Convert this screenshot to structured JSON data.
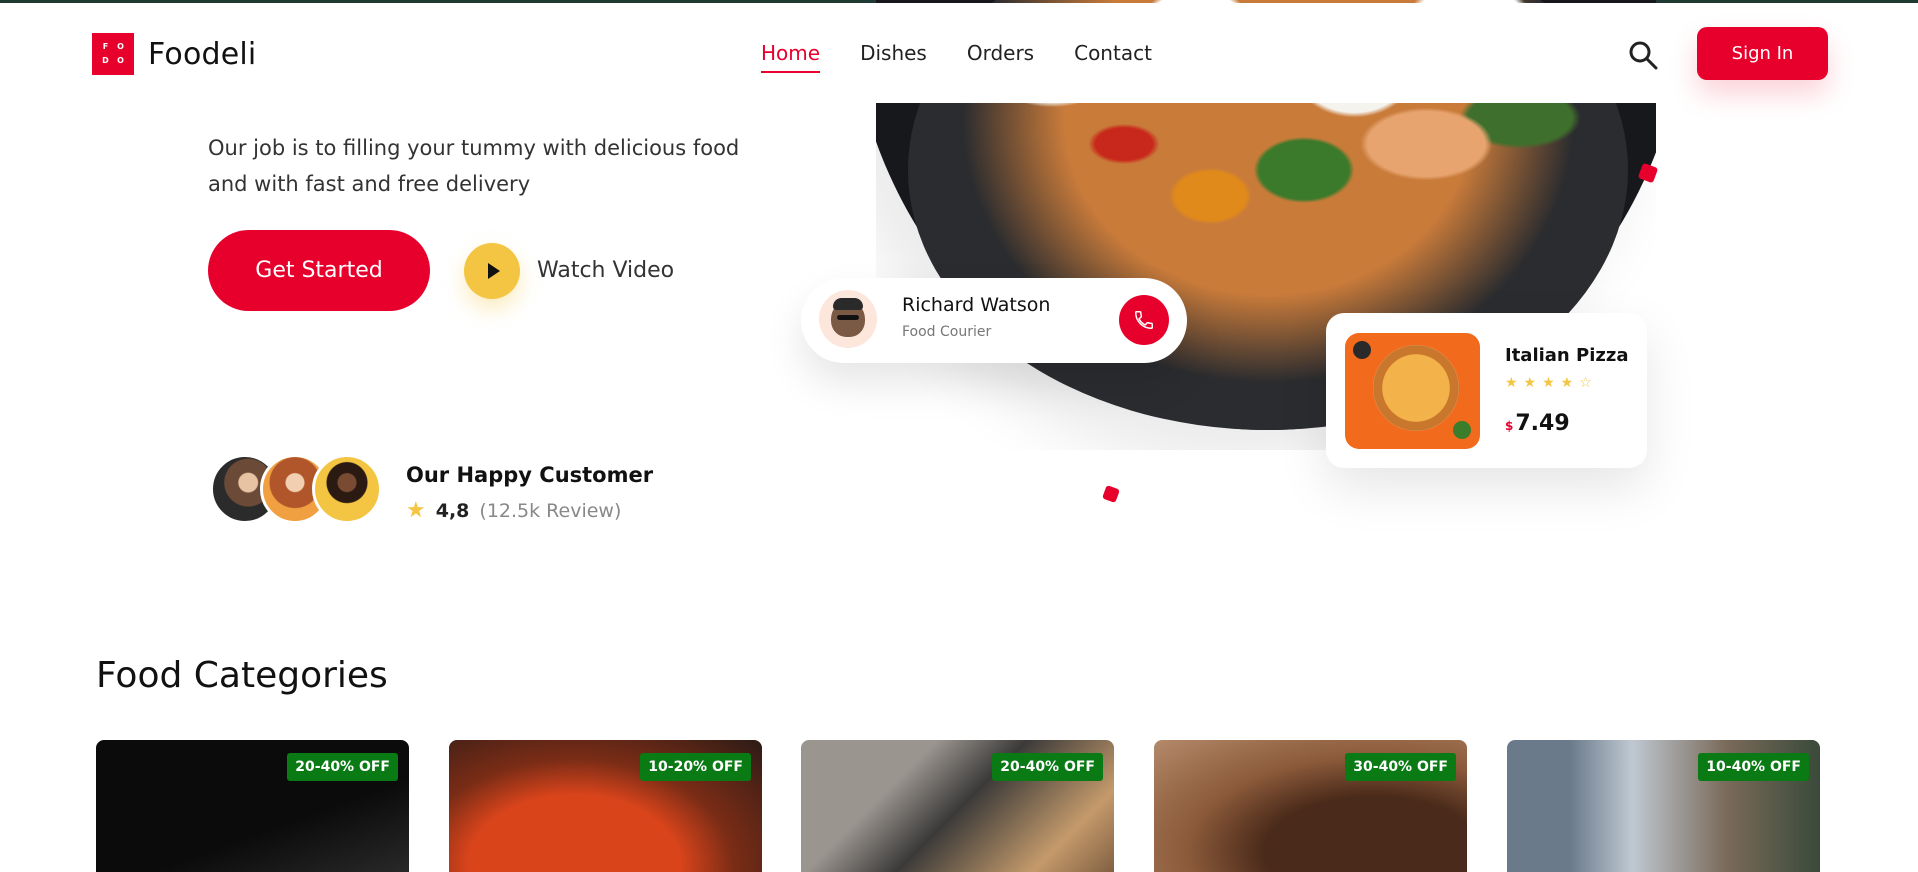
{
  "header": {
    "logo_letters": [
      "F",
      "O",
      "D",
      "O"
    ],
    "brand": "Foodeli",
    "nav": [
      {
        "label": "Home",
        "active": true
      },
      {
        "label": "Dishes",
        "active": false
      },
      {
        "label": "Orders",
        "active": false
      },
      {
        "label": "Contact",
        "active": false
      }
    ],
    "search_icon": "search-icon",
    "signin_label": "Sign In"
  },
  "hero": {
    "text_line1": "Our job is to filling your tummy with delicious food",
    "text_line2": "and  with fast and free delivery",
    "get_started_label": "Get Started",
    "watch_video_label": "Watch Video",
    "happy_customer_label": "Our Happy Customer",
    "rating_value": "4,8",
    "rating_reviews": "(12.5k Review)"
  },
  "courier": {
    "name": "Richard Watson",
    "role": "Food Courier",
    "call_icon": "phone-icon"
  },
  "featured_dish": {
    "title": "Italian Pizza",
    "rating_stars": 4,
    "stars_display": "★★★★☆",
    "currency": "$",
    "price": "7.49"
  },
  "categories": {
    "title": "Food Categories",
    "cards": [
      {
        "badge": "20-40% OFF"
      },
      {
        "badge": "10-20% OFF"
      },
      {
        "badge": "20-40% OFF"
      },
      {
        "badge": "30-40% OFF"
      },
      {
        "badge": "10-40% OFF"
      }
    ]
  },
  "colors": {
    "accent": "#e8002d",
    "yellow": "#f4c542",
    "badge_green": "#0a7a14"
  }
}
